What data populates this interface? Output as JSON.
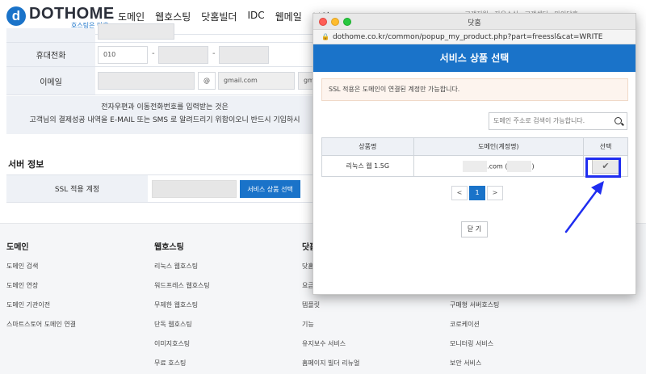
{
  "site": {
    "logo_mark": "d",
    "logo_text": "DOTHOME",
    "logo_sub": "호스팅은 닷홈",
    "nav": [
      "도메인",
      "웹호스팅",
      "닷홈빌더",
      "IDC",
      "웹메일",
      "보안"
    ],
    "top_links": "고객지원 · 자유소식 · 고객센터 · 마이닷홈"
  },
  "form": {
    "mobile_label": "휴대전화",
    "mobile_prefix": "010",
    "email_label": "이메일",
    "email_at": "@",
    "email_domain": "gmail.com",
    "email_domain2": "gmail",
    "dash": "-",
    "notice_line1": "전자우편과 이동전화번호를 입력받는 것은",
    "notice_line2": "고객님의 결제성공 내역을 E-MAIL 또는 SMS 로 알려드리기 위함이오니 반드시 기입하시"
  },
  "server": {
    "title": "서버 정보",
    "ssl_label": "SSL 적용 계정",
    "select_button": "서비스 상품 선택"
  },
  "footer": {
    "columns": [
      {
        "head": "도메인",
        "items": [
          "도메인 검색",
          "도메인 연장",
          "도메인 기관이전",
          "스마트스토어 도메인 연결"
        ]
      },
      {
        "head": "웹호스팅",
        "items": [
          "리눅스 웹호스팅",
          "워드프레스 웹호스팅",
          "무제한 웹호스팅",
          "단독 웹호스팅",
          "이미지호스팅",
          "무료 호스팅"
        ]
      },
      {
        "head": "닷홈",
        "items": [
          "닷홈",
          "요금",
          "템플릿",
          "기능",
          "유지보수 서비스",
          "홈페이지 빌더 리뉴얼"
        ]
      },
      {
        "head": "",
        "items": [
          "구매형 서버호스팅",
          "코로케이션",
          "모니터링 서비스",
          "보안 서비스"
        ]
      }
    ]
  },
  "popup": {
    "window_title": "닷홈",
    "url": "dothome.co.kr/common/popup_my_product.php?part=freessl&cat=WRITE",
    "header": "서비스 상품 선택",
    "alert": "SSL 적용은 도메인이 연결된 계정만 가능합니다.",
    "search_placeholder": "도메인 주소로 검색이 가능합니다.",
    "table": {
      "headers": [
        "상품명",
        "도메인(계정명)",
        "선택"
      ],
      "rows": [
        {
          "product": "리눅스 웹 1.5G",
          "domain_suffix": ".com (",
          "account_suffix": ")",
          "select": "✔"
        }
      ]
    },
    "pager": {
      "prev": "<",
      "current": "1",
      "next": ">"
    },
    "close_button": "닫 기"
  },
  "colors": {
    "brand": "#1a73c9",
    "highlight": "#1f2df0"
  }
}
